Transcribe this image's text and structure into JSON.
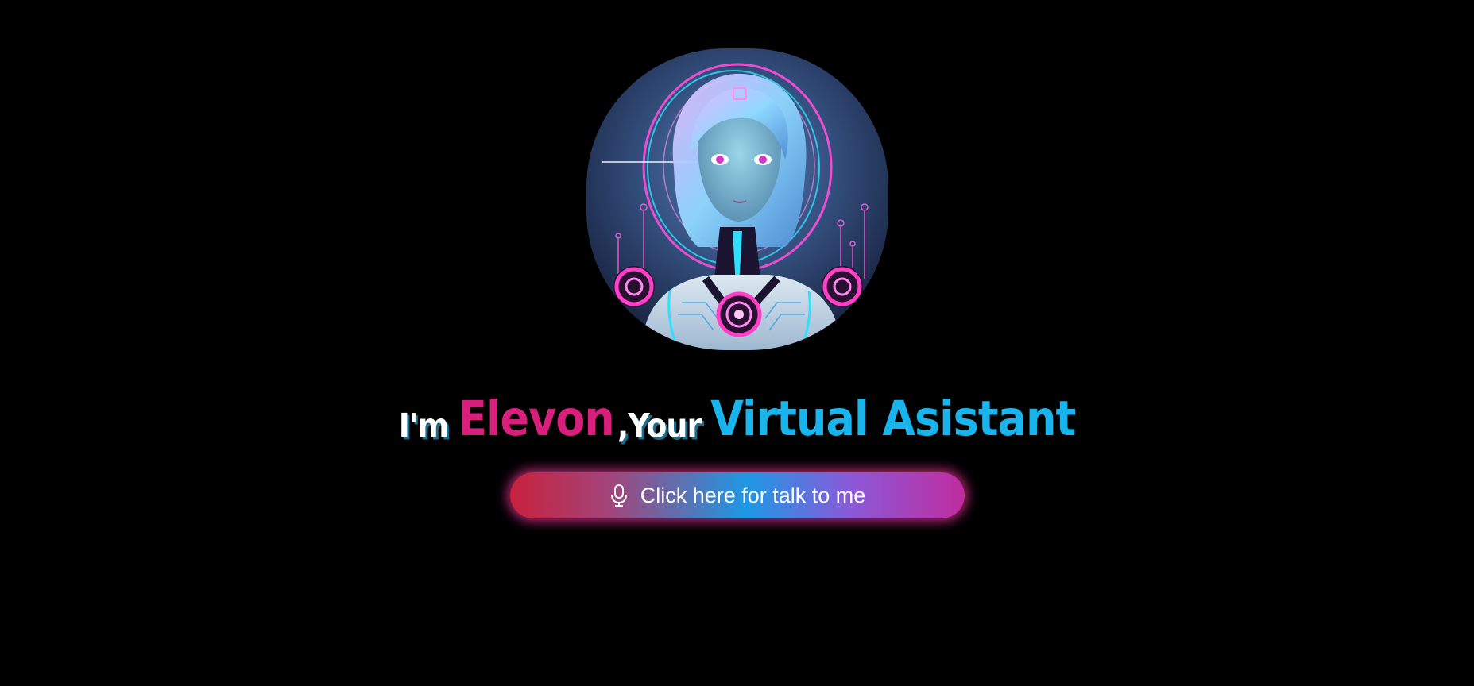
{
  "hero": {
    "avatar_alt": "neon robot assistant portrait",
    "headline": {
      "prefix": "I'm",
      "name": "Elevon",
      "connector": ",Your",
      "role": "Virtual Asistant"
    },
    "talk_button": {
      "label": "Click here for talk to me",
      "icon": "microphone-icon"
    }
  },
  "colors": {
    "background": "#000000",
    "name_accent": "#d91f7c",
    "role_accent": "#19b4ec",
    "button_glow": "#e83496"
  }
}
